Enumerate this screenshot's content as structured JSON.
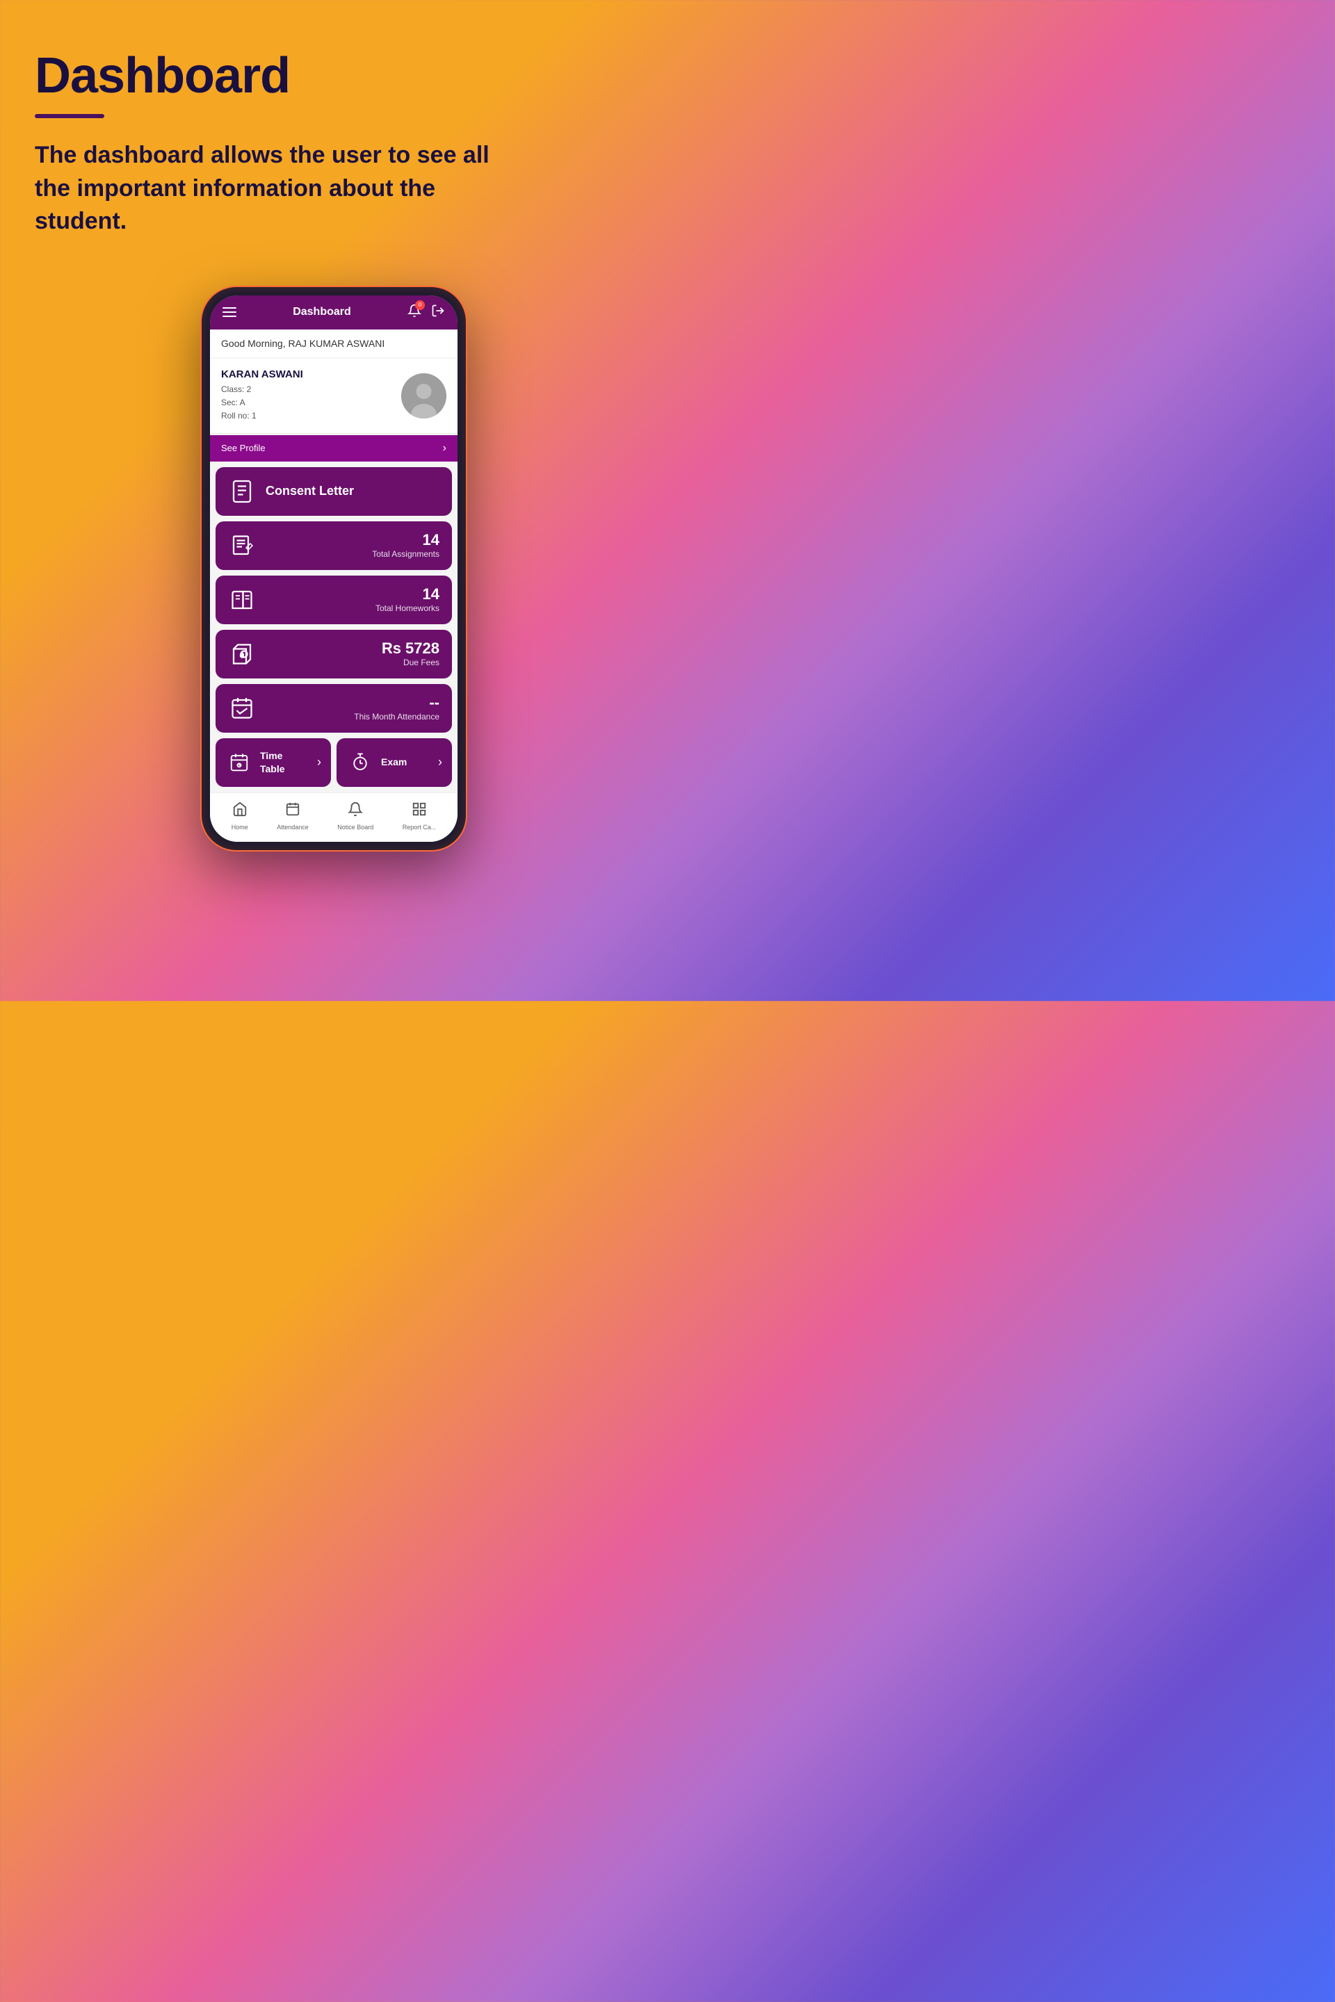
{
  "page": {
    "title": "Dashboard",
    "underline": true,
    "description": "The dashboard allows the user to see all the important information about the student."
  },
  "phone": {
    "header": {
      "menu_icon": "≡",
      "title": "Dashboard",
      "notification_icon": "🔔",
      "notification_count": "0",
      "profile_icon": "⎋"
    },
    "greeting": "Good Morning, RAJ KUMAR ASWANI",
    "student": {
      "name": "KARAN ASWANI",
      "class": "Class: 2",
      "section": "Sec: A",
      "roll": "Roll no: 1"
    },
    "see_profile_label": "See Profile",
    "menu_items": [
      {
        "id": "consent-letter",
        "icon": "clipboard",
        "label": "Consent Letter",
        "show_label": true,
        "show_number": false
      },
      {
        "id": "assignments",
        "icon": "assignments",
        "label": "Total Assignments",
        "number": "14",
        "show_label": false,
        "show_number": true
      },
      {
        "id": "homeworks",
        "icon": "homework",
        "label": "Total Homeworks",
        "number": "14",
        "show_label": false,
        "show_number": true
      },
      {
        "id": "fees",
        "icon": "tag",
        "label": "Due Fees",
        "number": "Rs 5728",
        "show_label": false,
        "show_number": true
      },
      {
        "id": "attendance",
        "icon": "calendar-check",
        "label": "This Month Attendance",
        "number": "--",
        "show_label": false,
        "show_number": true
      }
    ],
    "bottom_row": [
      {
        "id": "timetable",
        "icon": "timetable",
        "label": "Time\nTable",
        "has_arrow": true
      },
      {
        "id": "exam",
        "icon": "exam",
        "label": "Exam",
        "has_arrow": true
      }
    ],
    "bottom_nav": [
      {
        "icon": "home",
        "label": "Home"
      },
      {
        "icon": "calendar",
        "label": "Attendance"
      },
      {
        "icon": "bell",
        "label": "Notice Board"
      },
      {
        "icon": "grid",
        "label": "Report Ca..."
      }
    ]
  }
}
